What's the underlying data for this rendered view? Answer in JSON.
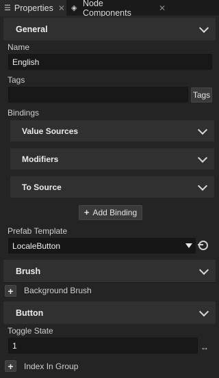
{
  "tabs": [
    {
      "label": "Properties",
      "icon": "list-icon",
      "active": true
    },
    {
      "label": "Node Components",
      "icon": "components-icon",
      "active": false
    }
  ],
  "sections": {
    "general": "General",
    "brush": "Brush",
    "button": "Button"
  },
  "name": {
    "label": "Name",
    "value": "English"
  },
  "tags": {
    "label": "Tags",
    "value": "",
    "button": "Tags"
  },
  "bindings": {
    "label": "Bindings",
    "groups": [
      "Value Sources",
      "Modifiers",
      "To Source"
    ],
    "add_button": "Add Binding"
  },
  "prefab": {
    "label": "Prefab Template",
    "value": "LocaleButton"
  },
  "brush": {
    "background_label": "Background Brush"
  },
  "toggle": {
    "label": "Toggle State",
    "value": "1"
  },
  "index_in_group": "Index In Group"
}
